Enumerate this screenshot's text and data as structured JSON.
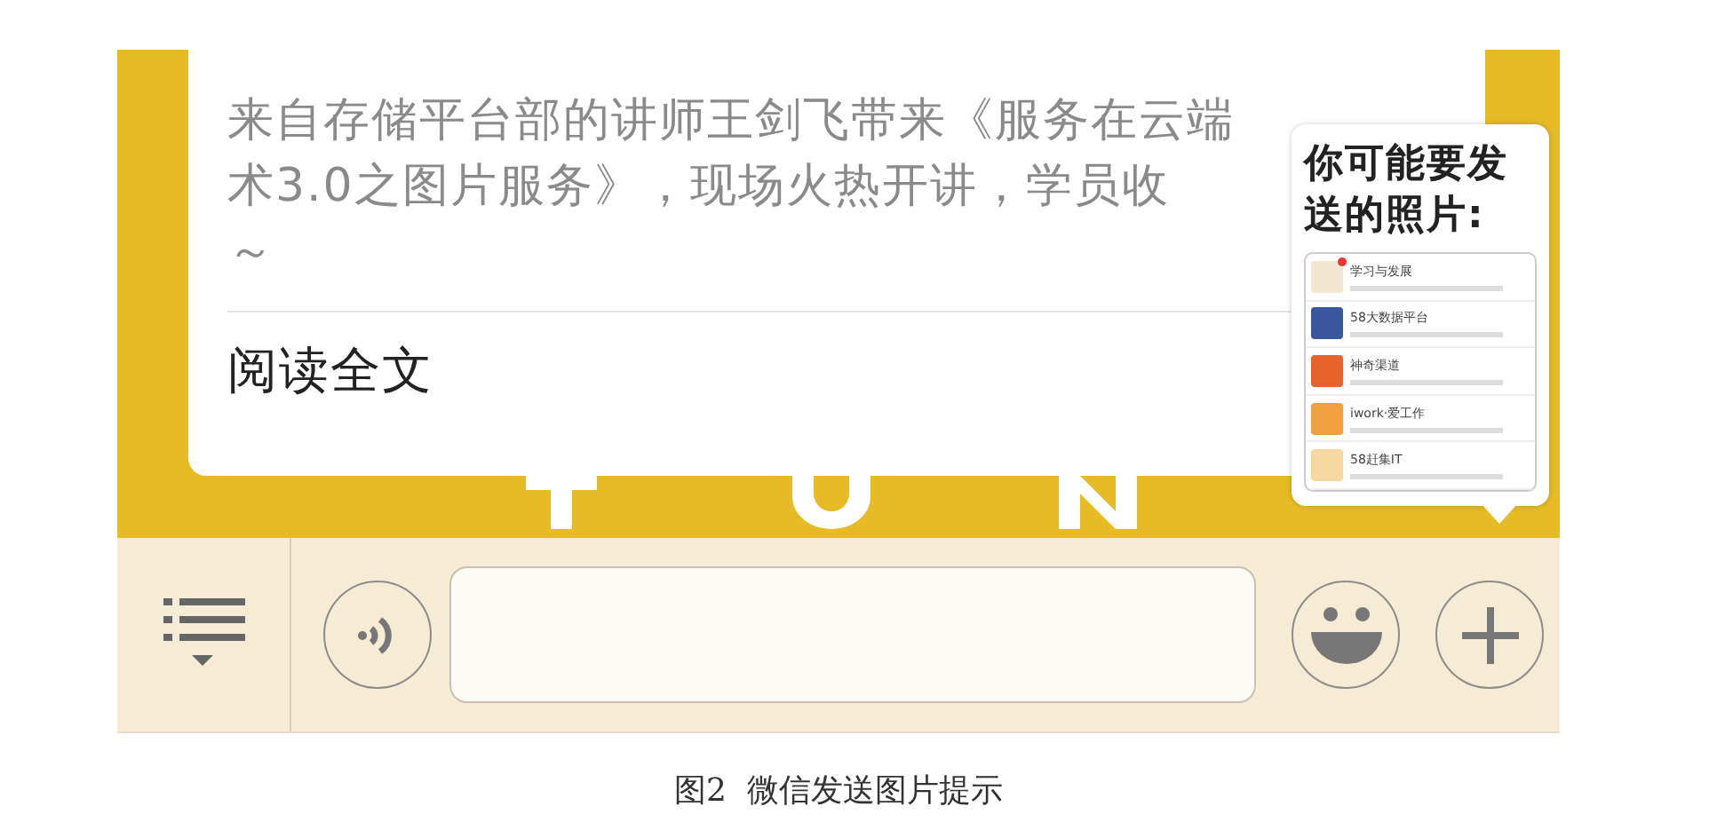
{
  "article_card": {
    "lines": [
      "来自存储平台部的讲师王剑飞带来《服务在云端",
      "术3.0之图片服务》，现场火热开讲，学员收",
      "～"
    ],
    "read_more": "阅读全文"
  },
  "photo_suggestion": {
    "title": "你可能要发送的照片:",
    "thumbnail_rows": [
      {
        "title": "学习与发展",
        "unread": true
      },
      {
        "title": "58大数据平台",
        "unread": false
      },
      {
        "title": "神奇渠道",
        "unread": false
      },
      {
        "title": "iwork·爱工作",
        "unread": false
      },
      {
        "title": "58赶集IT",
        "unread": false
      }
    ]
  },
  "caption": "图2  微信发送图片提示"
}
